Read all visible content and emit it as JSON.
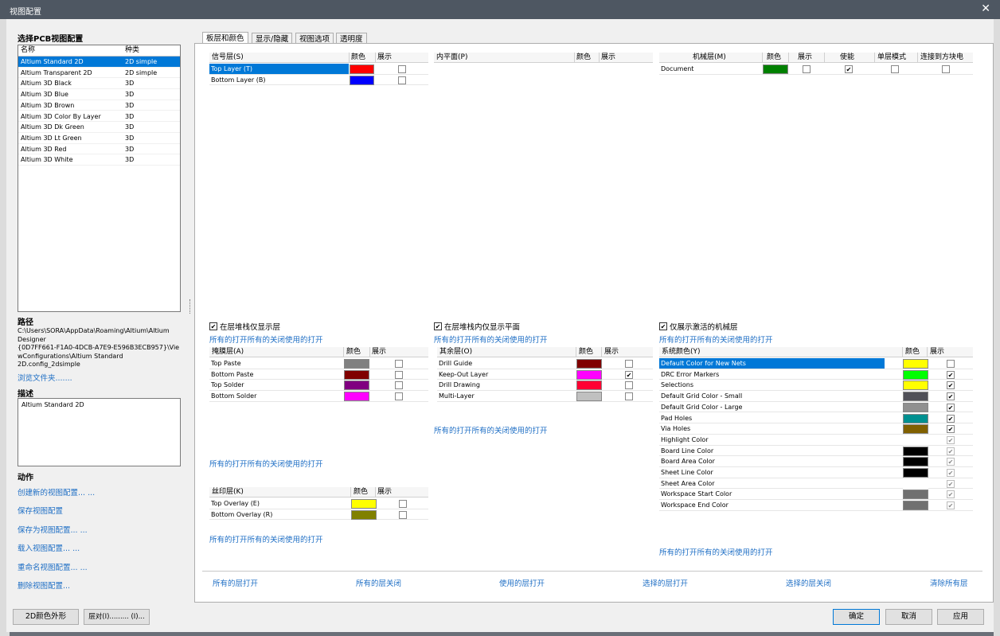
{
  "window": {
    "title": "视图配置",
    "close": "✕"
  },
  "left": {
    "header": "选择PCB视图配置",
    "columns": [
      "名称",
      "种类"
    ],
    "configs": [
      {
        "name": "Altium Standard 2D",
        "kind": "2D simple"
      },
      {
        "name": "Altium Transparent 2D",
        "kind": "2D simple"
      },
      {
        "name": "Altium 3D Black",
        "kind": "3D"
      },
      {
        "name": "Altium 3D Blue",
        "kind": "3D"
      },
      {
        "name": "Altium 3D Brown",
        "kind": "3D"
      },
      {
        "name": "Altium 3D Color By Layer",
        "kind": "3D"
      },
      {
        "name": "Altium 3D Dk Green",
        "kind": "3D"
      },
      {
        "name": "Altium 3D Lt Green",
        "kind": "3D"
      },
      {
        "name": "Altium 3D Red",
        "kind": "3D"
      },
      {
        "name": "Altium 3D White",
        "kind": "3D"
      }
    ],
    "path_label": "路径",
    "path_lines": [
      "C:\\Users\\SORA\\AppData\\Roaming\\Altium\\Altium",
      "Designer",
      "{0D7FF661-F1A0-4DCB-A7E9-E596B3ECB957}\\Vie",
      "wConfigurations\\Altium Standard",
      "2D.config_2dsimple"
    ],
    "browse": "浏览文件夹.......",
    "desc_label": "描述",
    "desc_value": "Altium Standard 2D",
    "actions_label": "动作",
    "actions": [
      "创建新的视图配置... ...",
      "保存视图配置",
      "保存为视图配置... ...",
      "载入视图配置... ...",
      "重命名视图配置... ...",
      "删除视图配置..."
    ]
  },
  "tabs": [
    "板层和颜色",
    "显示/隐藏",
    "视图选项",
    "透明度"
  ],
  "signal": {
    "h": "信号层(S)",
    "c": "颜色",
    "s": "展示",
    "rows": [
      {
        "n": "Top Layer (T)",
        "color": "#ff0000",
        "show": false
      },
      {
        "n": "Bottom Layer (B)",
        "color": "#0000ff",
        "show": false
      }
    ]
  },
  "plane": {
    "h": "内平面(P)",
    "c": "颜色",
    "s": "展示"
  },
  "mech": {
    "h": "机械层(M)",
    "c": "颜色",
    "s": "展示",
    "e": "使能",
    "single": "单层模式",
    "link": "连接到方块电",
    "rows": [
      {
        "n": "Document",
        "color": "#008000",
        "show": false,
        "enable": true,
        "single": false,
        "link": false
      }
    ]
  },
  "checks": {
    "c1": "在层堆栈仅显示层",
    "c2": "在层堆栈内仅显示平面",
    "c3": "仅展示激活的机械层"
  },
  "link_text": "所有的打开所有的关闭使用的打开",
  "mask": {
    "h": "掩膜层(A)",
    "c": "颜色",
    "s": "展示",
    "rows": [
      {
        "n": "Top Paste",
        "color": "#808080"
      },
      {
        "n": "Bottom Paste",
        "color": "#800000"
      },
      {
        "n": "Top Solder",
        "color": "#800080"
      },
      {
        "n": "Bottom Solder",
        "color": "#ff00ff"
      }
    ]
  },
  "other": {
    "h": "其余层(O)",
    "c": "颜色",
    "s": "展示",
    "rows": [
      {
        "n": "Drill Guide",
        "color": "#800000",
        "show": false
      },
      {
        "n": "Keep-Out Layer",
        "color": "#ff00ff",
        "show": true
      },
      {
        "n": "Drill Drawing",
        "color": "#ff0033",
        "show": false
      },
      {
        "n": "Multi-Layer",
        "color": "#c0c0c0",
        "show": false
      }
    ]
  },
  "silk": {
    "h": "丝印层(K)",
    "c": "颜色",
    "s": "展示",
    "rows": [
      {
        "n": "Top Overlay (E)",
        "color": "#ffff00"
      },
      {
        "n": "Bottom Overlay (R)",
        "color": "#808000"
      }
    ]
  },
  "sys": {
    "h": "系统颜色(Y)",
    "c": "颜色",
    "s": "展示",
    "rows": [
      {
        "n": "Default Color for New Nets",
        "color": "#ffff00",
        "show": false,
        "dis": false,
        "sel": true
      },
      {
        "n": "DRC Error Markers",
        "color": "#00ff00",
        "show": true,
        "dis": false
      },
      {
        "n": "Selections",
        "color": "#ffff00",
        "show": true,
        "dis": false
      },
      {
        "n": "Default Grid Color - Small",
        "color": "#505058",
        "show": true,
        "dis": false
      },
      {
        "n": "Default Grid Color - Large",
        "color": "#909090",
        "show": true,
        "dis": false
      },
      {
        "n": "Pad Holes",
        "color": "#009090",
        "show": true,
        "dis": false
      },
      {
        "n": "Via Holes",
        "color": "#806000",
        "show": true,
        "dis": false
      },
      {
        "n": "Highlight Color",
        "color": "#ffffff",
        "show": true,
        "dis": true
      },
      {
        "n": "Board Line Color",
        "color": "#000000",
        "show": true,
        "dis": true
      },
      {
        "n": "Board Area Color",
        "color": "#000000",
        "show": true,
        "dis": true
      },
      {
        "n": "Sheet Line Color",
        "color": "#000000",
        "show": true,
        "dis": true
      },
      {
        "n": "Sheet Area Color",
        "color": "#ffffff",
        "show": true,
        "dis": true
      },
      {
        "n": "Workspace Start Color",
        "color": "#707070",
        "show": true,
        "dis": true
      },
      {
        "n": "Workspace End Color",
        "color": "#707070",
        "show": true,
        "dis": true
      }
    ]
  },
  "bottom_links": [
    "所有的层打开",
    "所有的层关闭",
    "使用的层打开",
    "选择的层打开",
    "选择的层关闭",
    "清除所有层"
  ],
  "buttons": {
    "shape": "2D颜色外形",
    "layer": "层对(I)......... (I)...",
    "ok": "确定",
    "cancel": "取消",
    "apply": "应用"
  }
}
